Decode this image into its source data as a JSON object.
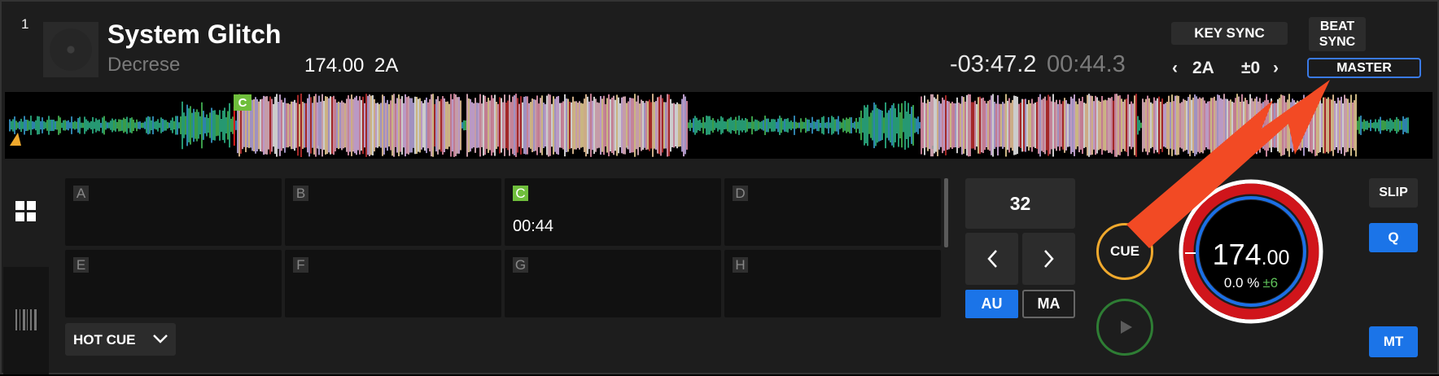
{
  "deck": {
    "number": "1",
    "track_title": "System Glitch",
    "artist": "Decrese",
    "bpm": "174.00",
    "key": "2A",
    "time_remaining": "-03:47.2",
    "time_elapsed": "00:44.3"
  },
  "sync": {
    "key_sync_label": "KEY SYNC",
    "beat_sync_label": "BEAT SYNC",
    "master_label": "MASTER",
    "key_prev": "‹",
    "key_value": "2A",
    "key_offset": "±0",
    "key_next": "›"
  },
  "waveform": {
    "cue_marker_label": "C",
    "playhead_progress": 0.16
  },
  "pads": [
    {
      "label": "A",
      "time": "",
      "active": false
    },
    {
      "label": "B",
      "time": "",
      "active": false
    },
    {
      "label": "C",
      "time": "00:44",
      "active": true
    },
    {
      "label": "D",
      "time": "",
      "active": false
    },
    {
      "label": "E",
      "time": "",
      "active": false
    },
    {
      "label": "F",
      "time": "",
      "active": false
    },
    {
      "label": "G",
      "time": "",
      "active": false
    },
    {
      "label": "H",
      "time": "",
      "active": false
    }
  ],
  "pad_mode": "HOT CUE",
  "loop": {
    "length": "32",
    "auto_label": "AU",
    "manual_label": "MA"
  },
  "transport": {
    "cue_label": "CUE"
  },
  "jog": {
    "bpm_int": "174",
    "bpm_dec": ".00",
    "pitch": "0.0 %",
    "pitch_range": "±6"
  },
  "right_buttons": {
    "slip": "SLIP",
    "quantize": "Q",
    "master_tempo": "MT"
  },
  "colors": {
    "accent_blue": "#1b74e8",
    "cue_orange": "#f0a92d",
    "play_green": "#2e7d34",
    "hotcue_green": "#6fbe3c",
    "jog_red": "#d0151b",
    "annotation_arrow": "#f24a24"
  }
}
